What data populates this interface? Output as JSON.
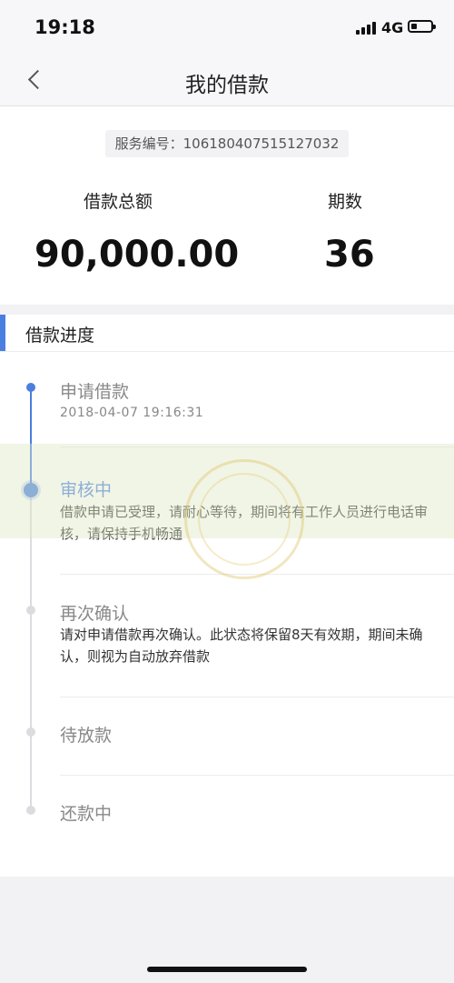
{
  "status_bar": {
    "time": "19:18",
    "network": "4G"
  },
  "nav": {
    "title": "我的借款"
  },
  "summary": {
    "serial_label": "服务编号：",
    "serial_number": "106180407515127032",
    "amount_label": "借款总额",
    "amount_value": "90,000.00",
    "term_label": "期数",
    "term_value": "36"
  },
  "progress": {
    "section_title": "借款进度",
    "steps": [
      {
        "title": "申请借款",
        "time": "2018-04-07 19:16:31"
      },
      {
        "title": "审核中",
        "desc": "借款申请已受理，请耐心等待，期间将有工作人员进行电话审核，请保持手机畅通"
      },
      {
        "title": "再次确认",
        "desc": "请对申请借款再次确认。此状态将保留8天有效期，期间未确认，则视为自动放弃借款"
      },
      {
        "title": "待放款"
      },
      {
        "title": "还款中"
      }
    ]
  },
  "colors": {
    "accent": "#4a7fe0",
    "muted": "#888888"
  }
}
